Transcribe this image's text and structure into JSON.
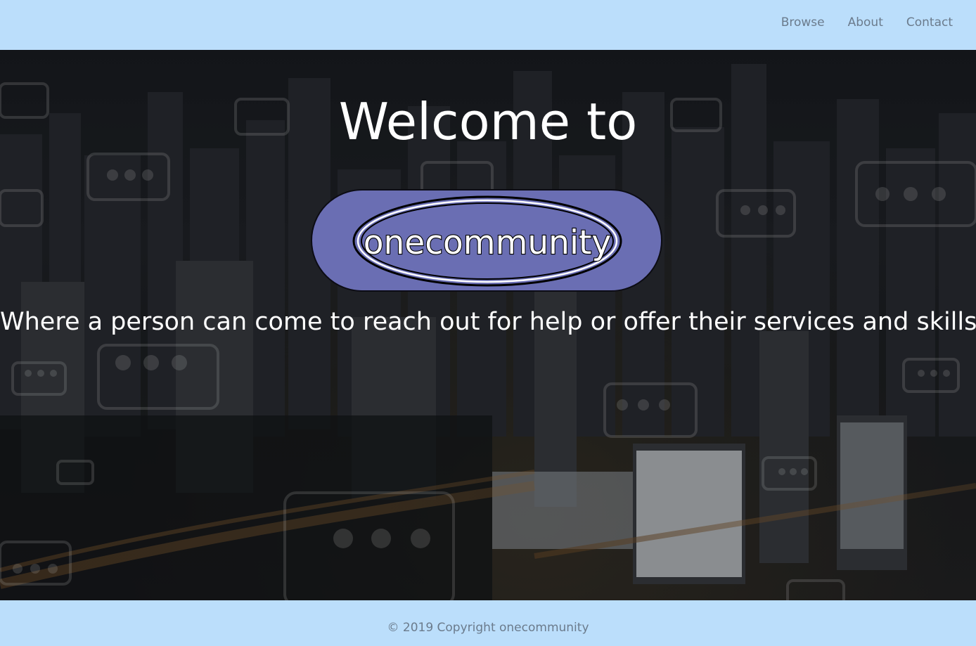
{
  "nav": {
    "items": [
      {
        "label": "Browse"
      },
      {
        "label": "About"
      },
      {
        "label": "Contact"
      }
    ]
  },
  "hero": {
    "title": "Welcome to",
    "logo_text": "onecommunity",
    "tagline": "Where a person can come to reach out for help or offer their services and skills"
  },
  "footer": {
    "copyright": "© 2019 Copyright onecommunity"
  },
  "colors": {
    "bar_background": "#bbdefb",
    "nav_text": "#6b7b8c",
    "logo_pill": "#6a6eb3",
    "hero_text": "#ffffff"
  }
}
